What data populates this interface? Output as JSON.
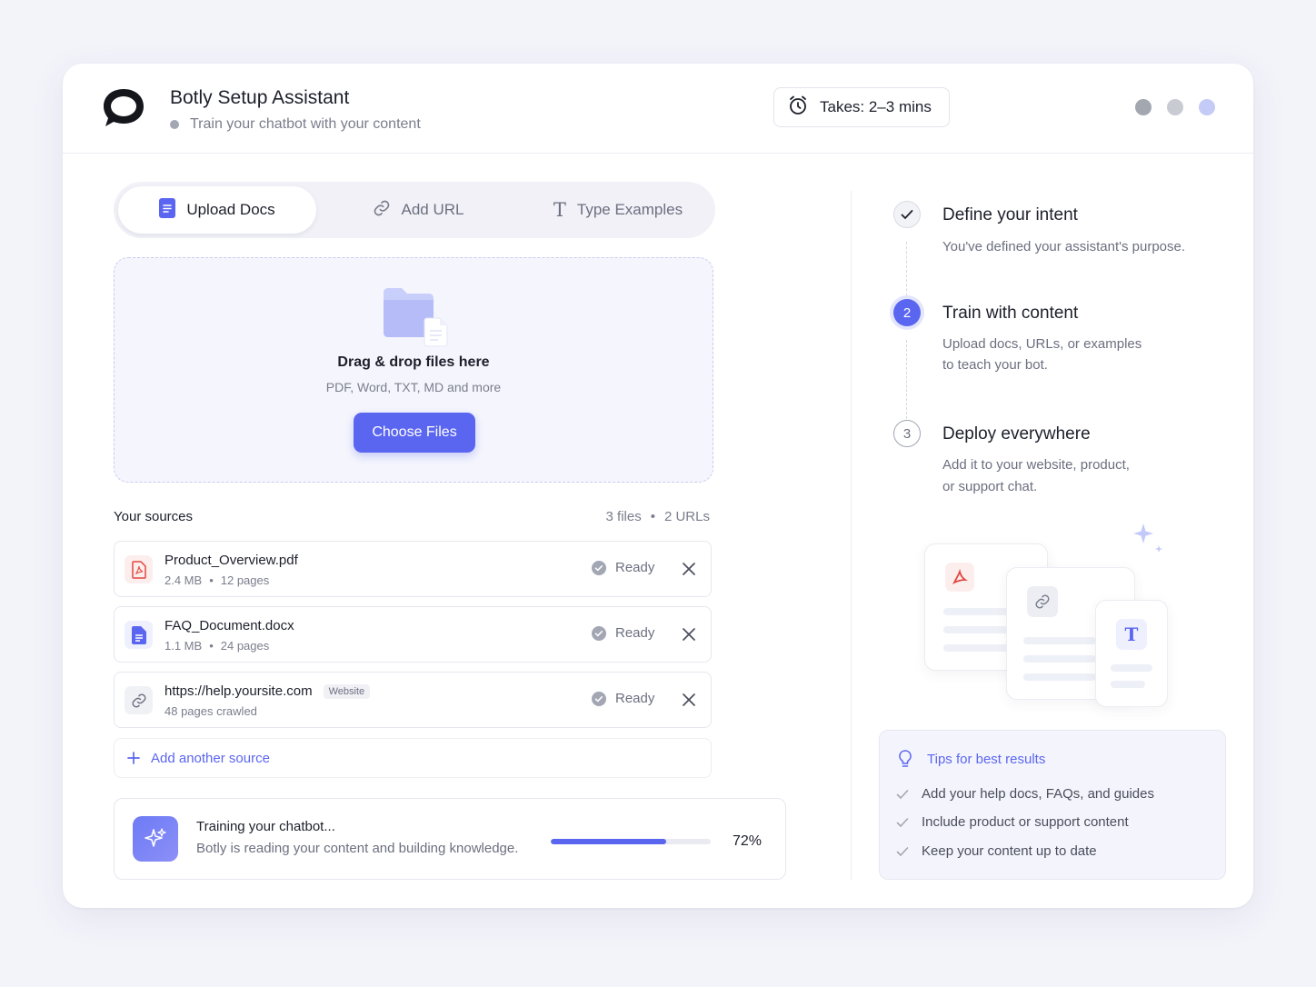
{
  "header": {
    "title": "Botly Setup Assistant",
    "subtitle": "Train your chatbot with your content",
    "time_label": "Takes: 2–3 mins",
    "icons": {
      "logo": "chat-bubble-logo",
      "time": "alarm-clock-icon"
    },
    "window_dots": [
      "#a3a7b0",
      "#c9cbd2",
      "#c4cbf7"
    ]
  },
  "tabs": [
    {
      "label": "Upload Docs",
      "icon": "document-icon",
      "active": true
    },
    {
      "label": "Add URL",
      "icon": "link-icon",
      "active": false
    },
    {
      "label": "Type Examples",
      "icon": "text-t-icon",
      "active": false
    }
  ],
  "dropzone": {
    "title": "Drag & drop files here",
    "subtitle": "PDF, Word, TXT, MD and more",
    "button": "Choose Files"
  },
  "sources": {
    "title": "Your sources",
    "files_count": "3 files",
    "urls_count": "2 URLs",
    "items": [
      {
        "name": "Product_Overview.pdf",
        "size": "2.4 MB",
        "pages": "12 pages",
        "status": "Ready",
        "icon": "pdf-icon"
      },
      {
        "name": "FAQ_Document.docx",
        "size": "1.1 MB",
        "pages": "24 pages",
        "status": "Ready",
        "icon": "doc-icon"
      },
      {
        "name": "https://help.yoursite.com",
        "badge": "Website",
        "meta": "48 pages crawled",
        "status": "Ready",
        "icon": "link-icon"
      }
    ],
    "add_label": "Add another source"
  },
  "training": {
    "title": "Training your chatbot...",
    "subtitle": "Botly is reading your content and building knowledge.",
    "progress": 72,
    "progress_label": "72%"
  },
  "steps": [
    {
      "num": "",
      "title": "Define your intent",
      "desc_1": "You've defined your assistant's purpose.",
      "desc_2": "",
      "state": "done"
    },
    {
      "num": "2",
      "title": "Train with content",
      "desc_1": "Upload docs, URLs, or examples",
      "desc_2": "to teach your bot.",
      "state": "active"
    },
    {
      "num": "3",
      "title": "Deploy everywhere",
      "desc_1": "Add it to your website, product,",
      "desc_2": "or support chat.",
      "state": "pending"
    }
  ],
  "tips": {
    "title": "Tips for best results",
    "items": [
      "Add your help docs, FAQs, and guides",
      "Include product or support content",
      "Keep your content up to date"
    ]
  },
  "colors": {
    "accent": "#5b66f0",
    "accent_light": "#c7cbf0"
  }
}
